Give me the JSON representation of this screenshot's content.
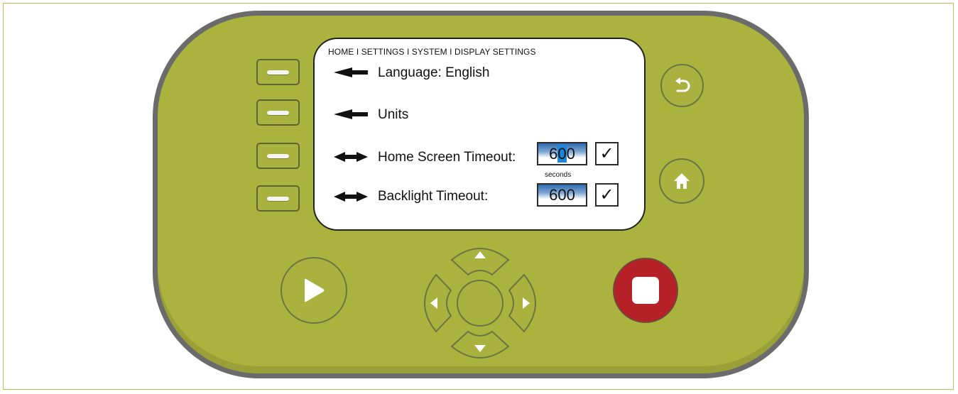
{
  "screen": {
    "breadcrumb": "HOME I SETTINGS I SYSTEM I DISPLAY SETTINGS",
    "menu_items": [
      {
        "label": "Language: English"
      },
      {
        "label": "Units"
      },
      {
        "label": "Home Screen Timeout:",
        "value_prefix": "6",
        "value_selected": "0",
        "value_suffix": "0",
        "checked": "✓"
      },
      {
        "label": "Backlight Timeout:",
        "value": "600",
        "checked": "✓"
      }
    ],
    "unit_label": "seconds"
  },
  "colors": {
    "device_body": "#aab33e",
    "device_border": "#6b6b6b",
    "stop_button": "#b52127",
    "selection_highlight": "#1d86d8"
  },
  "icons": {
    "back": "undo-arrow-icon",
    "home": "home-icon",
    "play": "play-icon",
    "stop": "stop-icon",
    "up": "triangle-up-icon",
    "down": "triangle-down-icon",
    "left": "triangle-left-icon",
    "right": "triangle-right-icon"
  }
}
